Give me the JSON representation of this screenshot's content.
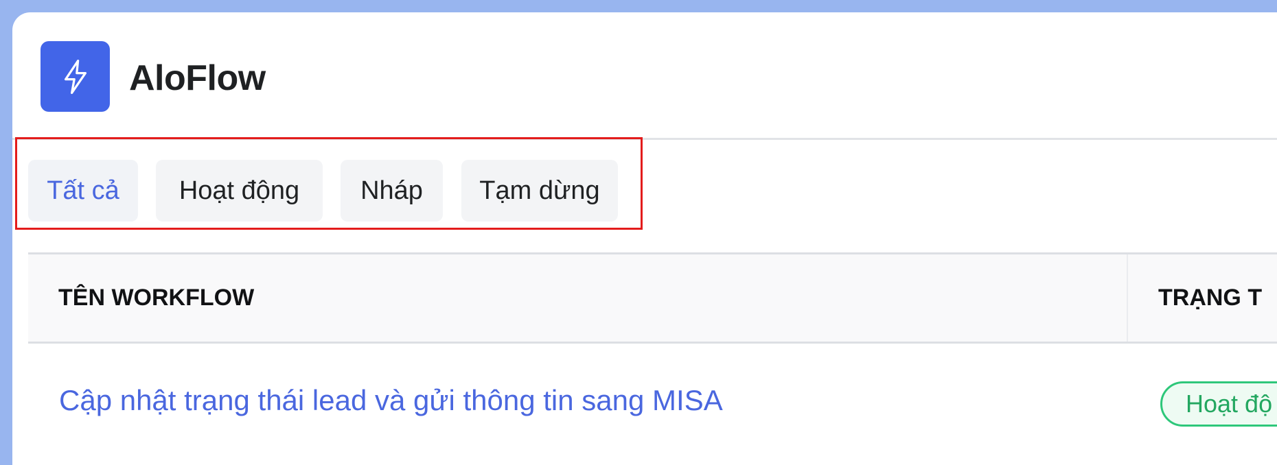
{
  "app": {
    "title": "AloFlow",
    "logo_icon": "lightning-bolt-icon",
    "brand_color": "#4265e8"
  },
  "tabs": [
    {
      "label": "Tất cả",
      "active": true
    },
    {
      "label": "Hoạt động",
      "active": false
    },
    {
      "label": "Nháp",
      "active": false
    },
    {
      "label": "Tạm dừng",
      "active": false
    }
  ],
  "table": {
    "columns": [
      "TÊN WORKFLOW",
      "TRẠNG T"
    ],
    "rows": [
      {
        "name": "Cập nhật trạng thái lead và gửi thông tin sang MISA",
        "status": "Hoạt độ"
      }
    ]
  },
  "colors": {
    "accent": "#4a67df",
    "highlight_box": "#e31c1c",
    "status_active": "#2ec77a"
  }
}
